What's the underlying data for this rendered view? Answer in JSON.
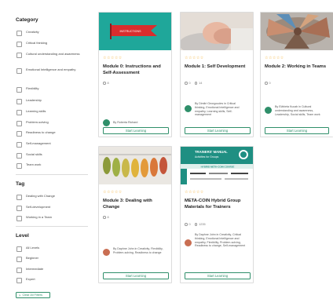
{
  "sidebar": {
    "category_title": "Category",
    "categories": [
      "Creativity",
      "Critical thinking",
      "Cultural understanding and awareness",
      "Emotional Intelligence and empathy",
      "Flexibility",
      "Leadership",
      "Learning skills",
      "Problem-solving",
      "Readiness to change",
      "Self-management",
      "Social skills",
      "Team work"
    ],
    "tag_title": "Tag",
    "tags": [
      "Dealing with Change",
      "Self-development",
      "Working in a Team"
    ],
    "level_title": "Level",
    "levels": [
      "All Levels",
      "Beginner",
      "Intermediate",
      "Expert"
    ],
    "clear_label": "Clear All Filters"
  },
  "cards": [
    {
      "title": "Module 0: Instructions and Self-Assessment",
      "lessons": "8",
      "students": "",
      "author": "By Roberta Richard",
      "button": "Start Learning",
      "stars": "☆☆☆☆☆"
    },
    {
      "title": "Module 1: Self Development",
      "lessons": "0",
      "students": "14",
      "author": "By Dimitri Georgoudes in Critical thinking, Emotional Intelligence and empathy, Learning skills, Self-management",
      "button": "Start Learning",
      "stars": "☆☆☆☆☆"
    },
    {
      "title": "Module 2: Working in Teams",
      "lessons": "0",
      "students": "",
      "author": "By Elżbieta Kucab in Cultural understanding and awareness, Leadership, Social skills, Team work",
      "button": "Start Learning",
      "stars": "☆☆☆☆☆"
    },
    {
      "title": "Module 3: Dealing with Change",
      "lessons": "8",
      "students": "",
      "author": "By Daphne John in Creativity, Flexibility, Problem-solving, Readiness to change",
      "button": "Start Learning",
      "stars": "☆☆☆☆☆"
    },
    {
      "title": "META-COIN Hybrid Group Materials for Trainers",
      "lessons": "0",
      "students": "1235",
      "author": "By Daphne John in Creativity, Critical thinking, Emotional Intelligence and empathy, Flexibility, Problem-solving, Readiness to change, Self-management",
      "button": "Start Learning",
      "stars": "☆☆☆☆☆"
    }
  ],
  "thumb_texts": {
    "card0_banner": "INSTRUCTIONS",
    "card4_line1": "TRAINERS' MANUAL",
    "card4_line2": "Activities for Groups",
    "card4_line3": "HYBRID META-COIN COURSE"
  }
}
